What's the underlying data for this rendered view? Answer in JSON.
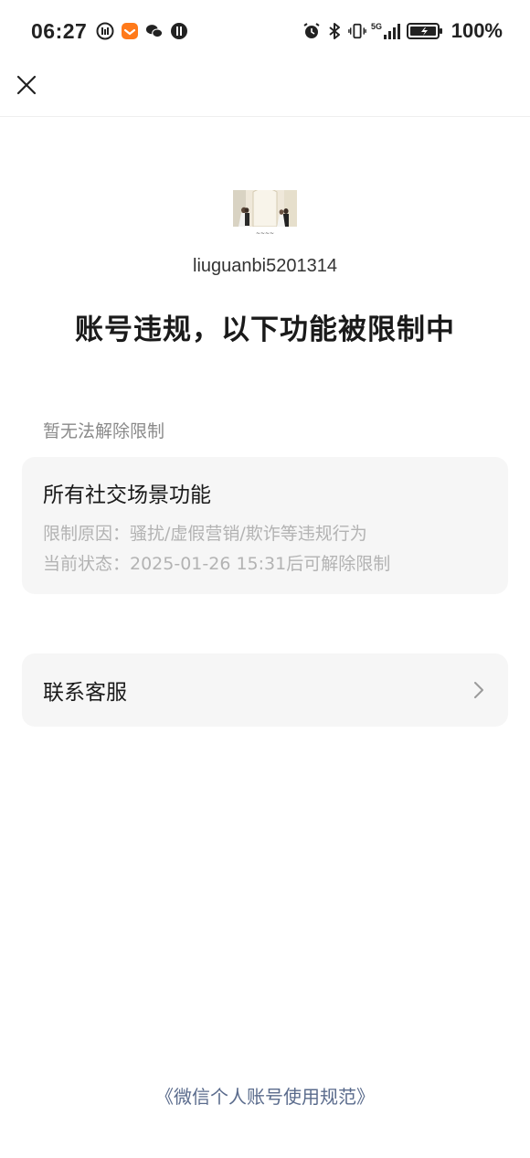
{
  "status_bar": {
    "time": "06:27",
    "left_icons": [
      "data-saver-icon",
      "taobao-icon",
      "wechat-icon",
      "notification-icon"
    ],
    "right_icons": [
      "alarm-icon",
      "bluetooth-icon",
      "vibrate-icon",
      "signal-5g-icon",
      "battery-icon"
    ],
    "network": "5G",
    "battery": "100%"
  },
  "nav": {
    "close_icon": "close-icon"
  },
  "profile": {
    "username": "liuguanbi5201314"
  },
  "headline": "账号违规，以下功能被限制中",
  "section_label": "暂无法解除限制",
  "restriction": {
    "title": "所有社交场景功能",
    "reason": "限制原因：骚扰/虚假营销/欺诈等违规行为",
    "status": "当前状态：2025-01-26 15:31后可解除限制"
  },
  "service": {
    "label": "联系客服",
    "chevron_icon": "chevron-right-icon"
  },
  "footer": {
    "link": "《微信个人账号使用规范》"
  },
  "colors": {
    "link": "#5a6b8c",
    "card_bg": "#f6f6f6",
    "muted_text": "#b3b3b3",
    "section_text": "#8a8a8a"
  }
}
